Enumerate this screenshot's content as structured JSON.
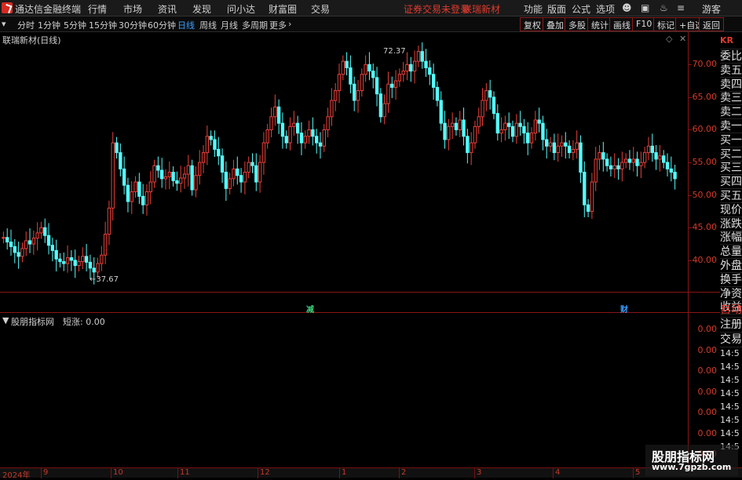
{
  "app": {
    "title": "通达信金融终端",
    "login_notice": "证券交易未登录",
    "stock_name": "联瑞新材",
    "guest": "游客"
  },
  "menu": {
    "items": [
      "行情",
      "市场",
      "资讯",
      "发现",
      "问小达",
      "财富圈",
      "交易"
    ],
    "right_items": [
      "功能",
      "版面",
      "公式",
      "选项"
    ]
  },
  "periods": [
    "分时",
    "1分钟",
    "5分钟",
    "15分钟",
    "30分钟",
    "60分钟",
    "日线",
    "周线",
    "月线",
    "多周期",
    "更多"
  ],
  "active_period": "日线",
  "toolbar_right": [
    "复权",
    "叠加",
    "多股",
    "统计",
    "画线",
    "F10",
    "标记",
    "+自选",
    "返回"
  ],
  "main_chart": {
    "title": "联瑞新材(日线)",
    "high_label": "72.37",
    "low_label": "37.67",
    "marker_jian": "减",
    "marker_cai": "财"
  },
  "sub_chart": {
    "title": "股朋指标网",
    "series_label": "短涨: 0.00"
  },
  "sidebar": {
    "top_badge": "KR",
    "items": [
      "委比",
      "卖五",
      "卖四",
      "卖三",
      "卖二",
      "卖一",
      "买一",
      "买二",
      "买三",
      "买四",
      "买五",
      "现价",
      "涨跌",
      "涨幅",
      "总量",
      "外盘",
      "换手",
      "净资",
      "收益"
    ],
    "items2": [
      "自动",
      "注册",
      "交易"
    ],
    "times": [
      "14:5",
      "14:5",
      "14:5",
      "14:5",
      "14:5",
      "14:5",
      "14:5",
      "14:5"
    ]
  },
  "status_bar": {
    "year": "2024年",
    "months": [
      "9",
      "10",
      "11",
      "12",
      "1",
      "2",
      "3",
      "4",
      "5"
    ]
  },
  "watermark": {
    "line1": "股朋指标网",
    "line2": "www.7gpzb.com"
  },
  "chart_data": {
    "type": "candlestick",
    "title": "联瑞新材(日线)",
    "y_ticks": [
      40.0,
      45.0,
      50.0,
      55.0,
      60.0,
      65.0,
      70.0
    ],
    "ylim": [
      36.5,
      74.0
    ],
    "sub_y_ticks": [
      "0.00",
      "0.00",
      "0.00",
      "0.00",
      "0.00",
      "0.00",
      "0.00",
      "0.00"
    ],
    "annotations": [
      {
        "text": "72.37",
        "type": "high"
      },
      {
        "text": "37.67",
        "type": "low"
      }
    ],
    "closes": [
      43.5,
      42.8,
      42.1,
      41.2,
      40.6,
      41.8,
      43.0,
      42.5,
      43.4,
      44.2,
      45.0,
      43.8,
      42.3,
      41.5,
      40.2,
      39.8,
      39.5,
      40.4,
      40.0,
      39.2,
      39.8,
      40.6,
      39.7,
      38.8,
      38.2,
      39.5,
      40.8,
      44.0,
      48.0,
      58.0,
      56.5,
      54.0,
      51.5,
      49.0,
      50.5,
      52.0,
      49.8,
      48.5,
      50.5,
      52.0,
      54.5,
      53.8,
      52.5,
      52.8,
      53.5,
      52.2,
      51.8,
      52.6,
      53.2,
      54.5,
      50.8,
      53.0,
      55.0,
      56.5,
      59.0,
      58.5,
      57.0,
      56.0,
      53.5,
      51.0,
      52.5,
      54.0,
      53.0,
      52.0,
      53.5,
      55.0,
      54.5,
      52.0,
      55.0,
      58.0,
      60.0,
      62.0,
      63.5,
      61.0,
      59.0,
      58.0,
      60.5,
      61.0,
      59.5,
      58.0,
      59.0,
      60.0,
      59.0,
      58.0,
      57.5,
      60.0,
      62.0,
      64.5,
      66.0,
      68.5,
      70.5,
      69.5,
      67.0,
      64.5,
      66.0,
      68.5,
      70.0,
      69.0,
      68.0,
      65.5,
      62.0,
      64.0,
      67.0,
      66.5,
      67.5,
      68.5,
      69.0,
      70.0,
      69.0,
      70.5,
      72.0,
      70.5,
      69.5,
      68.5,
      66.5,
      64.5,
      61.0,
      58.5,
      60.5,
      61.0,
      60.0,
      61.5,
      59.0,
      56.5,
      58.0,
      60.5,
      62.0,
      64.5,
      66.0,
      65.0,
      62.5,
      59.5,
      60.0,
      61.0,
      60.5,
      59.0,
      61.0,
      60.5,
      59.5,
      58.0,
      59.5,
      61.5,
      61.0,
      58.5,
      57.5,
      58.0,
      56.5,
      57.5,
      58.0,
      57.5,
      56.5,
      57.0,
      58.0,
      53.5,
      48.5,
      47.5,
      52.0,
      55.5,
      56.5,
      55.5,
      54.5,
      54.0,
      54.5,
      54.0,
      55.0,
      55.5,
      55.0,
      55.5,
      54.5,
      55.0,
      56.5,
      57.5,
      56.5,
      55.5,
      56.0,
      55.0,
      54.0,
      53.5,
      52.5
    ]
  }
}
